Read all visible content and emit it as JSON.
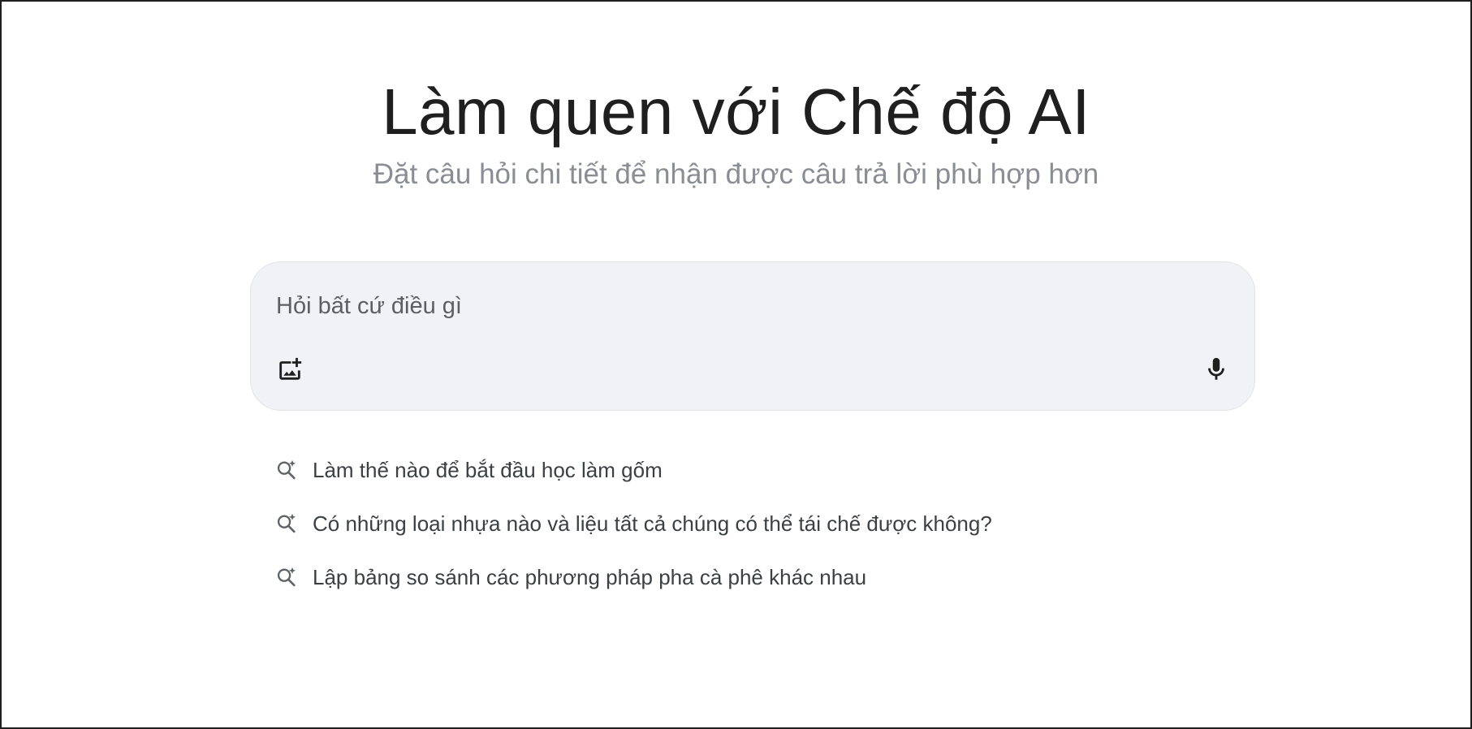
{
  "hero": {
    "title": "Làm quen với Chế độ AI",
    "subtitle": "Đặt câu hỏi chi tiết để nhận được câu trả lời phù hợp hơn"
  },
  "search": {
    "placeholder": "Hỏi bất cứ điều gì",
    "value": "",
    "left_icon": "add-image-icon",
    "right_icon": "microphone-icon"
  },
  "suggestions": [
    {
      "icon": "sparkle-search-icon",
      "label": "Làm thế nào để bắt đầu học làm gốm"
    },
    {
      "icon": "sparkle-search-icon",
      "label": "Có những loại nhựa nào và liệu tất cả chúng có thể tái chế được không?"
    },
    {
      "icon": "sparkle-search-icon",
      "label": "Lập bảng so sánh các phương pháp pha cà phê khác nhau"
    }
  ],
  "colors": {
    "title": "#1f1f1f",
    "subtitle": "#8a8d93",
    "search_background": "#f0f2f5",
    "suggestion_text": "#3c4043",
    "suggestion_icon": "#5f6368"
  }
}
